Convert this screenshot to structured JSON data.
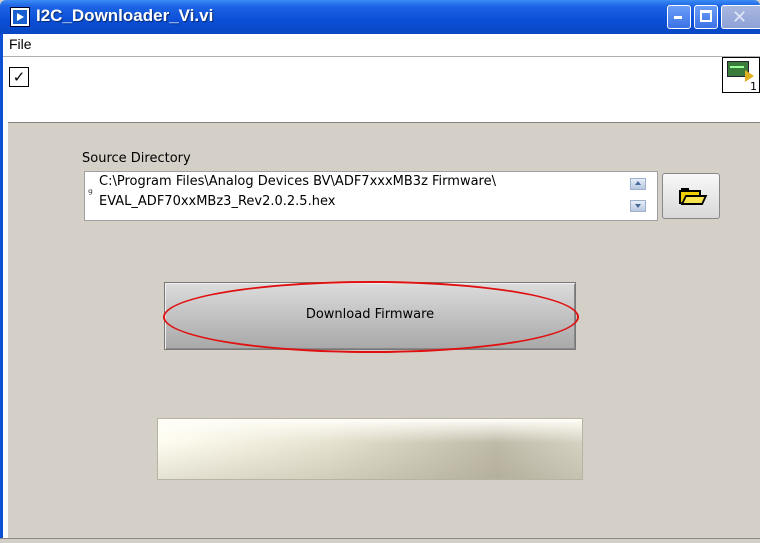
{
  "window": {
    "title": "I2C_Downloader_Vi.vi",
    "controls": [
      "minimize-icon",
      "maximize-icon",
      "close-icon"
    ]
  },
  "menu": {
    "items": [
      "File"
    ]
  },
  "toolbar": {
    "run_glyph": "✓",
    "vi_icon_number": "1"
  },
  "panel": {
    "source_label": "Source Directory",
    "path_line1": "C:\\Program Files\\Analog Devices BV\\ADF7xxxMB3z Firmware\\",
    "path_line2": "EVAL_ADF70xxMBz3_Rev2.0.2.5.hex",
    "path_glyph": "ᵍ",
    "download_label": "Download Firmware",
    "status_text": ""
  },
  "colors": {
    "accent": "#0a4fd6",
    "highlight": "#e01010"
  },
  "icons": [
    "labview-vi-icon",
    "folder-open-icon",
    "checkmark-icon"
  ]
}
